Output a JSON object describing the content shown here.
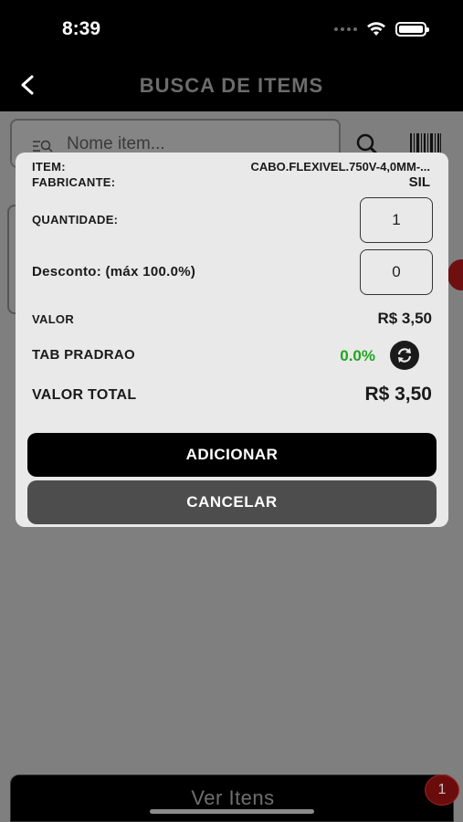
{
  "status_bar": {
    "time": "8:39"
  },
  "nav": {
    "title": "BUSCA DE ITEMS"
  },
  "search": {
    "placeholder": "Nome item..."
  },
  "modal": {
    "item_label": "ITEM:",
    "item_value": "CABO.FLEXIVEL.750V-4,0MM-...",
    "manufacturer_label": "FABRICANTE:",
    "manufacturer_value": "SIL",
    "quantity_label": "QUANTIDADE:",
    "quantity_value": "1",
    "discount_label": "Desconto: (máx 100.0%)",
    "discount_value": "0",
    "price_label": "VALOR",
    "price_value": "R$ 3,50",
    "table_label": "TAB PRADRAO",
    "table_percent": "0.0%",
    "total_label": "VALOR TOTAL",
    "total_value": "R$ 3,50",
    "add_button": "ADICIONAR",
    "cancel_button": "CANCELAR"
  },
  "bottom": {
    "label": "Ver Itens",
    "badge_count": "1"
  },
  "colors": {
    "accent_green": "#1fa61f",
    "badge_red": "#6b0c0c",
    "primary_button": "#000000",
    "secondary_button": "#4d4d4d"
  },
  "icons": [
    "back-chevron-icon",
    "wifi-icon",
    "battery-icon",
    "search-icon",
    "barcode-icon",
    "refresh-icon"
  ]
}
